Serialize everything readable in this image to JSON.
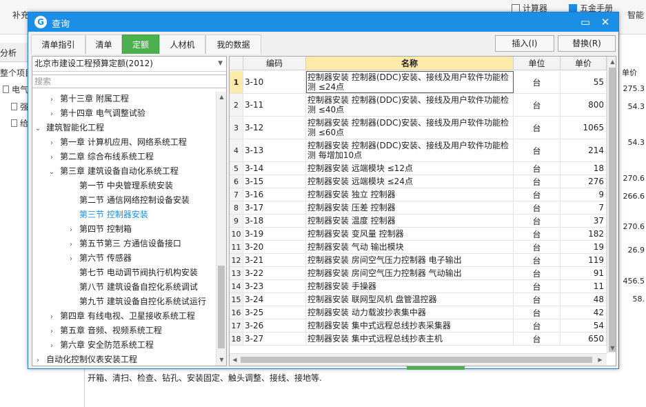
{
  "background": {
    "toolbar_left": [
      "补充"
    ],
    "toolbar_right": {
      "calculator": "计算器",
      "handbook": "五金手册",
      "smart": "智能"
    },
    "left_tab": "分析",
    "left_items": [
      "整个项目",
      "电气",
      "强",
      "给"
    ],
    "right_header": "单价",
    "right_values": [
      "275.3",
      "54.3",
      "54.3",
      "270.6",
      "266.6",
      "270.6",
      "26.9",
      "456.5",
      "58."
    ],
    "bottom_text": "开箱、清扫、检查、钻孔、安装固定、触头调整、接线、接地等."
  },
  "dialog": {
    "title": "查询",
    "minimize": "▭",
    "close": "✕",
    "tabs": [
      {
        "label": "清单指引",
        "active": false
      },
      {
        "label": "清单",
        "active": false
      },
      {
        "label": "定额",
        "active": true
      },
      {
        "label": "人材机",
        "active": false
      },
      {
        "label": "我的数据",
        "active": false
      }
    ],
    "insert_button": "插入(I)",
    "replace_button": "替换(R)",
    "quota_select": "北京市建设工程预算定额(2012)",
    "search_placeholder": "搜索",
    "tree": [
      {
        "label": "第十三章 附属工程",
        "level": 1,
        "toggle": "›",
        "selected": false
      },
      {
        "label": "第十四章 电气调整试验",
        "level": 1,
        "toggle": "›",
        "selected": false
      },
      {
        "label": "建筑智能化工程",
        "level": 0,
        "toggle": "⌄",
        "selected": false
      },
      {
        "label": "第一章 计算机应用、网络系统工程",
        "level": 1,
        "toggle": "›",
        "selected": false
      },
      {
        "label": "第二章 综合布线系统工程",
        "level": 1,
        "toggle": "›",
        "selected": false
      },
      {
        "label": "第三章 建筑设备自动化系统工程",
        "level": 1,
        "toggle": "⌄",
        "selected": false
      },
      {
        "label": "第一节 中央管理系统安装",
        "level": 2,
        "toggle": "",
        "selected": false
      },
      {
        "label": "第二节 通信网络控制设备安装",
        "level": 2,
        "toggle": "",
        "selected": false
      },
      {
        "label": "第三节 控制器安装",
        "level": 2,
        "toggle": "",
        "selected": true
      },
      {
        "label": "第四节 控制箱",
        "level": 2,
        "toggle": "›",
        "selected": false
      },
      {
        "label": "第五节第三 方通信设备接口",
        "level": 2,
        "toggle": "›",
        "selected": false
      },
      {
        "label": "第六节 传感器",
        "level": 2,
        "toggle": "›",
        "selected": false
      },
      {
        "label": "第七节 电动调节阀执行机构安装",
        "level": 2,
        "toggle": "",
        "selected": false
      },
      {
        "label": "第八节 建筑设备自控化系统调试",
        "level": 2,
        "toggle": "",
        "selected": false
      },
      {
        "label": "第九节 建筑设备自控化系统试运行",
        "level": 2,
        "toggle": "",
        "selected": false
      },
      {
        "label": "第四章 有线电视、卫星接收系统工程",
        "level": 1,
        "toggle": "›",
        "selected": false
      },
      {
        "label": "第五章 音频、视频系统工程",
        "level": 1,
        "toggle": "›",
        "selected": false
      },
      {
        "label": "第六章 安全防范系统工程",
        "level": 1,
        "toggle": "›",
        "selected": false
      },
      {
        "label": "自动化控制仪表安装工程",
        "level": 0,
        "toggle": "›",
        "selected": false
      }
    ],
    "columns": {
      "code": "编码",
      "name": "名称",
      "unit": "单位",
      "price": "单价"
    },
    "rows": [
      {
        "idx": "1",
        "code": "3-10",
        "name": "控制器安装 控制器(DDC)安装、接线及用户软件功能检测 ≤24点",
        "unit": "台",
        "price": "55",
        "tall": true,
        "selected": true
      },
      {
        "idx": "2",
        "code": "3-11",
        "name": "控制器安装 控制器(DDC)安装、接线及用户软件功能检测 ≤40点",
        "unit": "台",
        "price": "800",
        "tall": true,
        "selected": false
      },
      {
        "idx": "3",
        "code": "3-12",
        "name": "控制器安装 控制器(DDC)安装、接线及用户软件功能检测 ≤60点",
        "unit": "台",
        "price": "1065",
        "tall": true,
        "selected": false
      },
      {
        "idx": "4",
        "code": "3-13",
        "name": "控制器安装 控制器(DDC)安装、接线及用户软件功能检测 每增加10点",
        "unit": "台",
        "price": "214",
        "tall": true,
        "selected": false
      },
      {
        "idx": "5",
        "code": "3-14",
        "name": "控制器安装 远端模块 ≤12点",
        "unit": "台",
        "price": "18",
        "tall": false,
        "selected": false
      },
      {
        "idx": "6",
        "code": "3-15",
        "name": "控制器安装 远端模块 ≤24点",
        "unit": "台",
        "price": "276",
        "tall": false,
        "selected": false
      },
      {
        "idx": "7",
        "code": "3-16",
        "name": "控制器安装 独立 控制器",
        "unit": "台",
        "price": "9",
        "tall": false,
        "selected": false
      },
      {
        "idx": "8",
        "code": "3-17",
        "name": "控制器安装 压差 控制器",
        "unit": "台",
        "price": "7",
        "tall": false,
        "selected": false
      },
      {
        "idx": "9",
        "code": "3-18",
        "name": "控制器安装 温度 控制器",
        "unit": "台",
        "price": "37",
        "tall": false,
        "selected": false
      },
      {
        "idx": "10",
        "code": "3-19",
        "name": "控制器安装 变风量 控制器",
        "unit": "台",
        "price": "182",
        "tall": false,
        "selected": false
      },
      {
        "idx": "11",
        "code": "3-20",
        "name": "控制器安装 气动 输出模块",
        "unit": "台",
        "price": "19",
        "tall": false,
        "selected": false
      },
      {
        "idx": "12",
        "code": "3-21",
        "name": "控制器安装 房间空气压力控制器 电子输出",
        "unit": "台",
        "price": "119",
        "tall": false,
        "selected": false
      },
      {
        "idx": "13",
        "code": "3-22",
        "name": "控制器安装 房间空气压力控制器 气动输出",
        "unit": "台",
        "price": "91",
        "tall": false,
        "selected": false
      },
      {
        "idx": "14",
        "code": "3-23",
        "name": "控制器安装 手操器",
        "unit": "台",
        "price": "11",
        "tall": false,
        "selected": false
      },
      {
        "idx": "15",
        "code": "3-24",
        "name": "控制器安装 联网型风机 盘管温控器",
        "unit": "台",
        "price": "48",
        "tall": false,
        "selected": false
      },
      {
        "idx": "16",
        "code": "3-25",
        "name": "控制器安装 动力载波抄表集中器",
        "unit": "台",
        "price": "42",
        "tall": false,
        "selected": false
      },
      {
        "idx": "17",
        "code": "3-26",
        "name": "控制器安装 集中式远程总线抄表采集器",
        "unit": "台",
        "price": "54",
        "tall": false,
        "selected": false
      },
      {
        "idx": "18",
        "code": "3-27",
        "name": "控制器安装 集中式远程总线抄表主机",
        "unit": "台",
        "price": "650",
        "tall": false,
        "selected": false
      }
    ]
  }
}
